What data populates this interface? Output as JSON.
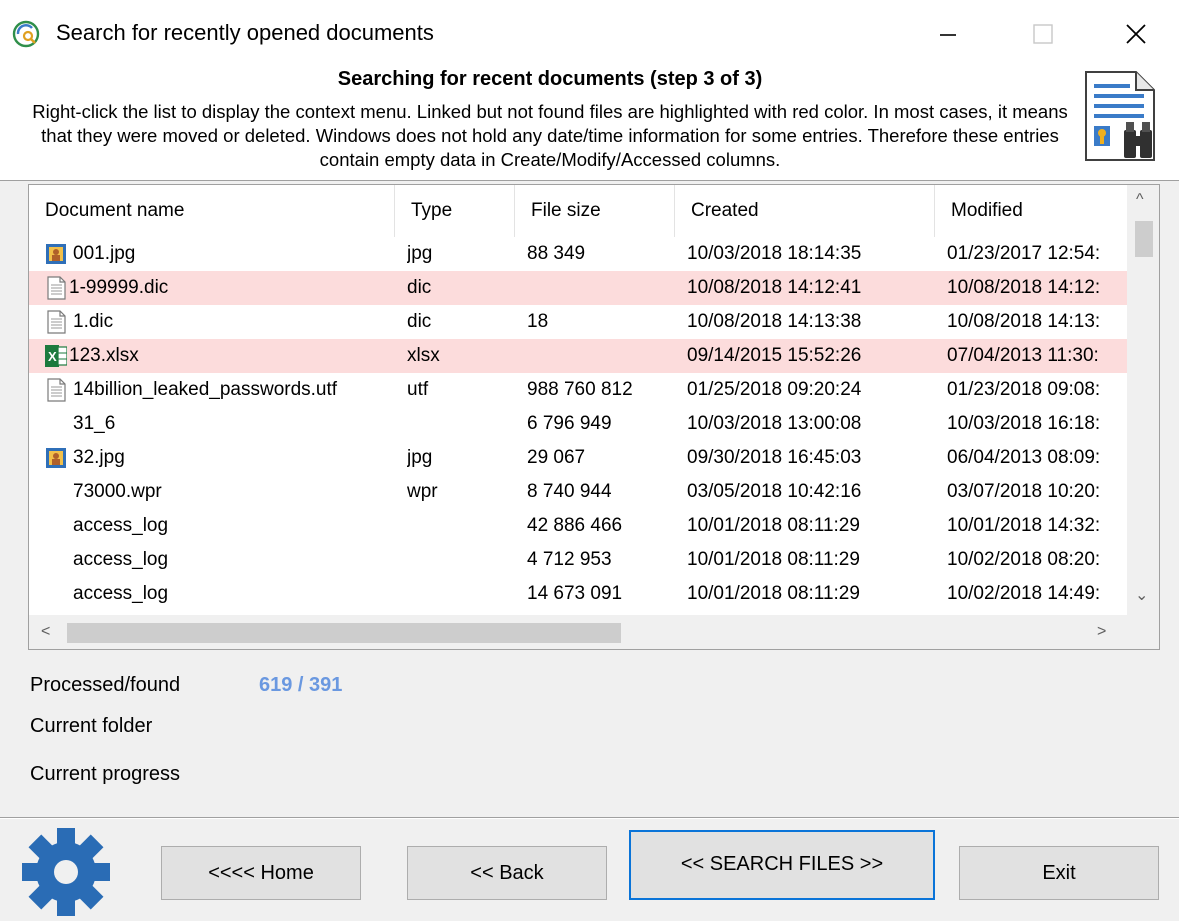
{
  "window": {
    "title": "Search for recently opened documents",
    "minimize_glyph": "—",
    "maximize_glyph": "☐",
    "close_glyph": "✕"
  },
  "header": {
    "step_title": "Searching for recent documents (step 3 of 3)",
    "instructions": "Right-click the list to display the context menu. Linked but not found files are highlighted with red color. In most cases, it means that they were moved or deleted. Windows does not hold any date/time information for some entries. Therefore these entries contain empty data in Create/Modify/Accessed columns."
  },
  "table": {
    "columns": [
      "Document name",
      "Type",
      "File size",
      "Created",
      "Modified"
    ],
    "rows": [
      {
        "icon": "image-file-icon",
        "name": "001.jpg",
        "type": "jpg",
        "size": "88 349",
        "created": "10/03/2018 18:14:35",
        "modified": "01/23/2017 12:54:",
        "missing": false
      },
      {
        "icon": "text-file-icon",
        "name": "1-99999.dic",
        "type": "dic",
        "size": "",
        "created": "10/08/2018 14:12:41",
        "modified": "10/08/2018 14:12:",
        "missing": true
      },
      {
        "icon": "text-file-icon",
        "name": "1.dic",
        "type": "dic",
        "size": "18",
        "created": "10/08/2018 14:13:38",
        "modified": "10/08/2018 14:13:",
        "missing": false
      },
      {
        "icon": "excel-file-icon",
        "name": "123.xlsx",
        "type": "xlsx",
        "size": "",
        "created": "09/14/2015 15:52:26",
        "modified": "07/04/2013 11:30:",
        "missing": true
      },
      {
        "icon": "text-file-icon",
        "name": "14billion_leaked_passwords.utf",
        "type": "utf",
        "size": "988 760 812",
        "created": "01/25/2018 09:20:24",
        "modified": "01/23/2018 09:08:",
        "missing": false
      },
      {
        "icon": "",
        "name": "31_6",
        "type": "",
        "size": "6 796 949",
        "created": "10/03/2018 13:00:08",
        "modified": "10/03/2018 16:18:",
        "missing": false
      },
      {
        "icon": "image-file-icon",
        "name": "32.jpg",
        "type": "jpg",
        "size": "29 067",
        "created": "09/30/2018 16:45:03",
        "modified": "06/04/2013 08:09:",
        "missing": false
      },
      {
        "icon": "",
        "name": "73000.wpr",
        "type": "wpr",
        "size": "8 740 944",
        "created": "03/05/2018 10:42:16",
        "modified": "03/07/2018 10:20:",
        "missing": false
      },
      {
        "icon": "",
        "name": "access_log",
        "type": "",
        "size": "42 886 466",
        "created": "10/01/2018 08:11:29",
        "modified": "10/01/2018 14:32:",
        "missing": false
      },
      {
        "icon": "",
        "name": "access_log",
        "type": "",
        "size": "4 712 953",
        "created": "10/01/2018 08:11:29",
        "modified": "10/02/2018 08:20:",
        "missing": false
      },
      {
        "icon": "",
        "name": "access_log",
        "type": "",
        "size": "14 673 091",
        "created": "10/01/2018 08:11:29",
        "modified": "10/02/2018 14:49:",
        "missing": false
      }
    ],
    "scroll_up_glyph": "^",
    "scroll_down_glyph": "⌄",
    "scroll_left_glyph": "<",
    "scroll_right_glyph": ">"
  },
  "status": {
    "processed_label": "Processed/found",
    "processed_value": "619 / 391",
    "folder_label": "Current folder",
    "progress_label": "Current progress"
  },
  "buttons": {
    "home": "<<<< Home",
    "back": "<< Back",
    "search": "<< SEARCH FILES >>",
    "exit": "Exit"
  },
  "colors": {
    "missing_row": "#fcdcdc",
    "status_value": "#6a98e0",
    "default_button_border": "#0a74d8",
    "gear": "#2a6cb5"
  }
}
